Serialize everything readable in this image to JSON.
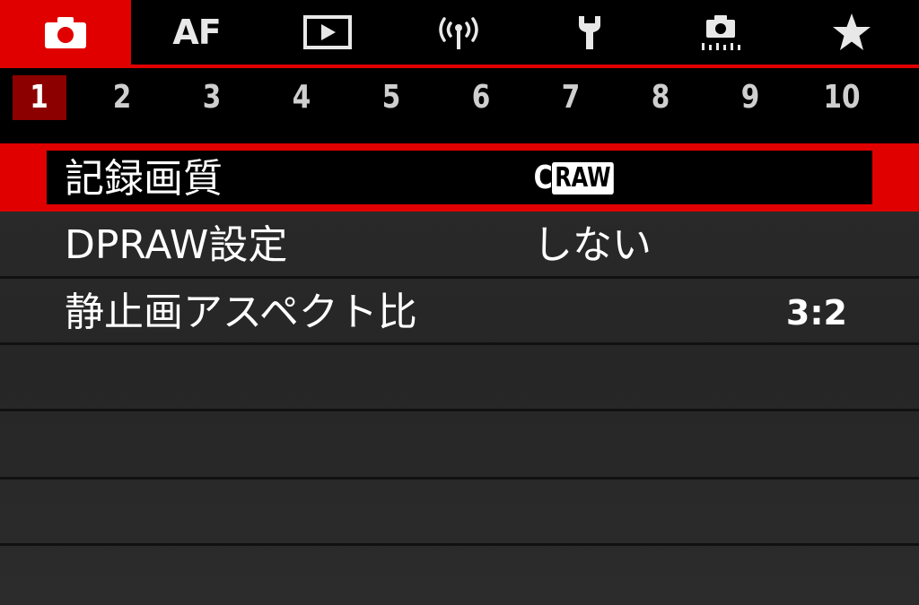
{
  "top_tabs": [
    {
      "id": "shooting",
      "icon": "camera-icon",
      "active": true
    },
    {
      "id": "af",
      "label": "AF"
    },
    {
      "id": "playback",
      "icon": "playback-icon"
    },
    {
      "id": "wireless",
      "icon": "wireless-icon"
    },
    {
      "id": "setup",
      "icon": "wrench-icon"
    },
    {
      "id": "custom",
      "icon": "custom-functions-icon"
    },
    {
      "id": "my_menu",
      "icon": "star-icon"
    }
  ],
  "page_numbers": [
    "1",
    "2",
    "3",
    "4",
    "5",
    "6",
    "7",
    "8",
    "9",
    "10"
  ],
  "active_page": "1",
  "menu_items": [
    {
      "label": "記録画質",
      "value_prefix": "C",
      "value_badge": "RAW",
      "selected": true
    },
    {
      "label": "DPRAW設定",
      "value": "しない"
    },
    {
      "label": "静止画アスペクト比",
      "value": "3:2"
    }
  ],
  "colors": {
    "accent": "#e00000",
    "active_page_bg": "#8c0000",
    "background": "#222222",
    "text": "#ffffff"
  }
}
